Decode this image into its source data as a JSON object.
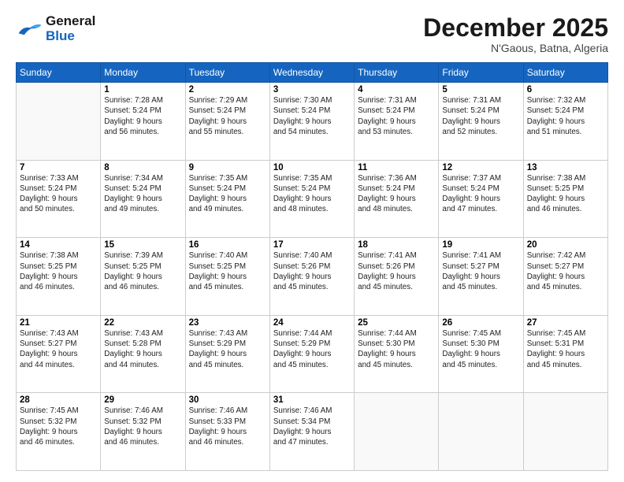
{
  "logo": {
    "line1": "General",
    "line2": "Blue"
  },
  "title": "December 2025",
  "subtitle": "N'Gaous, Batna, Algeria",
  "days_of_week": [
    "Sunday",
    "Monday",
    "Tuesday",
    "Wednesday",
    "Thursday",
    "Friday",
    "Saturday"
  ],
  "weeks": [
    [
      {
        "day": "",
        "content": ""
      },
      {
        "day": "1",
        "content": "Sunrise: 7:28 AM\nSunset: 5:24 PM\nDaylight: 9 hours\nand 56 minutes."
      },
      {
        "day": "2",
        "content": "Sunrise: 7:29 AM\nSunset: 5:24 PM\nDaylight: 9 hours\nand 55 minutes."
      },
      {
        "day": "3",
        "content": "Sunrise: 7:30 AM\nSunset: 5:24 PM\nDaylight: 9 hours\nand 54 minutes."
      },
      {
        "day": "4",
        "content": "Sunrise: 7:31 AM\nSunset: 5:24 PM\nDaylight: 9 hours\nand 53 minutes."
      },
      {
        "day": "5",
        "content": "Sunrise: 7:31 AM\nSunset: 5:24 PM\nDaylight: 9 hours\nand 52 minutes."
      },
      {
        "day": "6",
        "content": "Sunrise: 7:32 AM\nSunset: 5:24 PM\nDaylight: 9 hours\nand 51 minutes."
      }
    ],
    [
      {
        "day": "7",
        "content": "Sunrise: 7:33 AM\nSunset: 5:24 PM\nDaylight: 9 hours\nand 50 minutes."
      },
      {
        "day": "8",
        "content": "Sunrise: 7:34 AM\nSunset: 5:24 PM\nDaylight: 9 hours\nand 49 minutes."
      },
      {
        "day": "9",
        "content": "Sunrise: 7:35 AM\nSunset: 5:24 PM\nDaylight: 9 hours\nand 49 minutes."
      },
      {
        "day": "10",
        "content": "Sunrise: 7:35 AM\nSunset: 5:24 PM\nDaylight: 9 hours\nand 48 minutes."
      },
      {
        "day": "11",
        "content": "Sunrise: 7:36 AM\nSunset: 5:24 PM\nDaylight: 9 hours\nand 48 minutes."
      },
      {
        "day": "12",
        "content": "Sunrise: 7:37 AM\nSunset: 5:24 PM\nDaylight: 9 hours\nand 47 minutes."
      },
      {
        "day": "13",
        "content": "Sunrise: 7:38 AM\nSunset: 5:25 PM\nDaylight: 9 hours\nand 46 minutes."
      }
    ],
    [
      {
        "day": "14",
        "content": "Sunrise: 7:38 AM\nSunset: 5:25 PM\nDaylight: 9 hours\nand 46 minutes."
      },
      {
        "day": "15",
        "content": "Sunrise: 7:39 AM\nSunset: 5:25 PM\nDaylight: 9 hours\nand 46 minutes."
      },
      {
        "day": "16",
        "content": "Sunrise: 7:40 AM\nSunset: 5:25 PM\nDaylight: 9 hours\nand 45 minutes."
      },
      {
        "day": "17",
        "content": "Sunrise: 7:40 AM\nSunset: 5:26 PM\nDaylight: 9 hours\nand 45 minutes."
      },
      {
        "day": "18",
        "content": "Sunrise: 7:41 AM\nSunset: 5:26 PM\nDaylight: 9 hours\nand 45 minutes."
      },
      {
        "day": "19",
        "content": "Sunrise: 7:41 AM\nSunset: 5:27 PM\nDaylight: 9 hours\nand 45 minutes."
      },
      {
        "day": "20",
        "content": "Sunrise: 7:42 AM\nSunset: 5:27 PM\nDaylight: 9 hours\nand 45 minutes."
      }
    ],
    [
      {
        "day": "21",
        "content": "Sunrise: 7:43 AM\nSunset: 5:27 PM\nDaylight: 9 hours\nand 44 minutes."
      },
      {
        "day": "22",
        "content": "Sunrise: 7:43 AM\nSunset: 5:28 PM\nDaylight: 9 hours\nand 44 minutes."
      },
      {
        "day": "23",
        "content": "Sunrise: 7:43 AM\nSunset: 5:29 PM\nDaylight: 9 hours\nand 45 minutes."
      },
      {
        "day": "24",
        "content": "Sunrise: 7:44 AM\nSunset: 5:29 PM\nDaylight: 9 hours\nand 45 minutes."
      },
      {
        "day": "25",
        "content": "Sunrise: 7:44 AM\nSunset: 5:30 PM\nDaylight: 9 hours\nand 45 minutes."
      },
      {
        "day": "26",
        "content": "Sunrise: 7:45 AM\nSunset: 5:30 PM\nDaylight: 9 hours\nand 45 minutes."
      },
      {
        "day": "27",
        "content": "Sunrise: 7:45 AM\nSunset: 5:31 PM\nDaylight: 9 hours\nand 45 minutes."
      }
    ],
    [
      {
        "day": "28",
        "content": "Sunrise: 7:45 AM\nSunset: 5:32 PM\nDaylight: 9 hours\nand 46 minutes."
      },
      {
        "day": "29",
        "content": "Sunrise: 7:46 AM\nSunset: 5:32 PM\nDaylight: 9 hours\nand 46 minutes."
      },
      {
        "day": "30",
        "content": "Sunrise: 7:46 AM\nSunset: 5:33 PM\nDaylight: 9 hours\nand 46 minutes."
      },
      {
        "day": "31",
        "content": "Sunrise: 7:46 AM\nSunset: 5:34 PM\nDaylight: 9 hours\nand 47 minutes."
      },
      {
        "day": "",
        "content": ""
      },
      {
        "day": "",
        "content": ""
      },
      {
        "day": "",
        "content": ""
      }
    ]
  ]
}
